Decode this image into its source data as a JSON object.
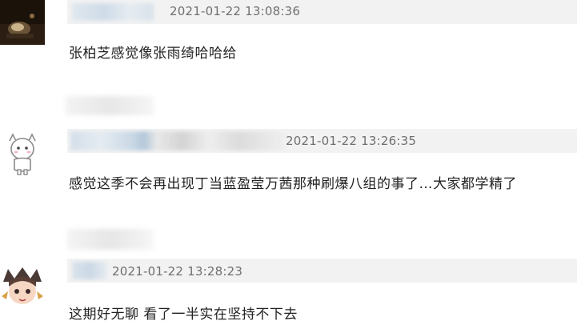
{
  "comments": [
    {
      "timestamp": "2021-01-22 13:08:36",
      "text": "张柏芝感觉像张雨绮哈哈给"
    },
    {
      "timestamp": "2021-01-22 13:26:35",
      "text": "感觉这季不会再出现丁当蓝盈莹万茜那种刷爆八组的事了…大家都学精了"
    },
    {
      "timestamp": "2021-01-22 13:28:23",
      "text": "这期好无聊 看了一半实在坚持不下去"
    }
  ],
  "colors": {
    "meta_bar": "#f2f2f2",
    "timestamp": "#6f6f6f",
    "text": "#222222"
  },
  "icons": [
    "cat-avatar-icon",
    "ghost-avatar-icon",
    "anime-avatar-icon"
  ]
}
